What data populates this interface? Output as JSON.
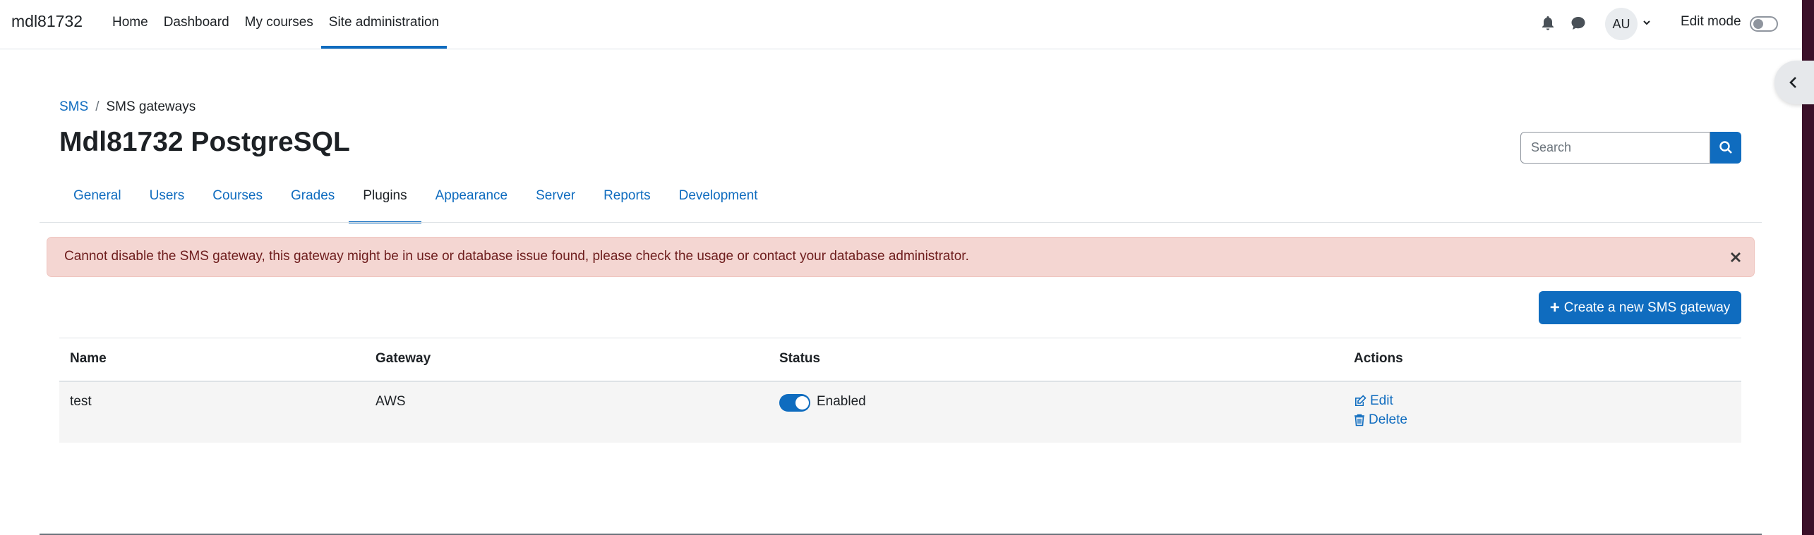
{
  "navbar": {
    "brand": "mdl81732",
    "links": [
      "Home",
      "Dashboard",
      "My courses",
      "Site administration"
    ],
    "active_link": "Site administration",
    "avatar_initials": "AU",
    "edit_mode_label": "Edit mode",
    "edit_mode_on": false
  },
  "breadcrumb": {
    "items": [
      "SMS",
      "SMS gateways"
    ],
    "separator": "/"
  },
  "page": {
    "title": "Mdl81732 PostgreSQL"
  },
  "search": {
    "placeholder": "Search"
  },
  "tabs": {
    "items": [
      "General",
      "Users",
      "Courses",
      "Grades",
      "Plugins",
      "Appearance",
      "Server",
      "Reports",
      "Development"
    ],
    "active": "Plugins"
  },
  "alert": {
    "message": "Cannot disable the SMS gateway, this gateway might be in use or database issue found, please check the usage or contact your database administrator."
  },
  "actions": {
    "create_label": "Create a new SMS gateway"
  },
  "table": {
    "headers": [
      "Name",
      "Gateway",
      "Status",
      "Actions"
    ],
    "rows": [
      {
        "name": "test",
        "gateway": "AWS",
        "status": "Enabled",
        "enabled": true,
        "edit_label": "Edit",
        "delete_label": "Delete"
      }
    ]
  },
  "colors": {
    "primary": "#0f6cbf",
    "alert_bg": "#f4d6d2",
    "alert_text": "#6e1d1d"
  }
}
